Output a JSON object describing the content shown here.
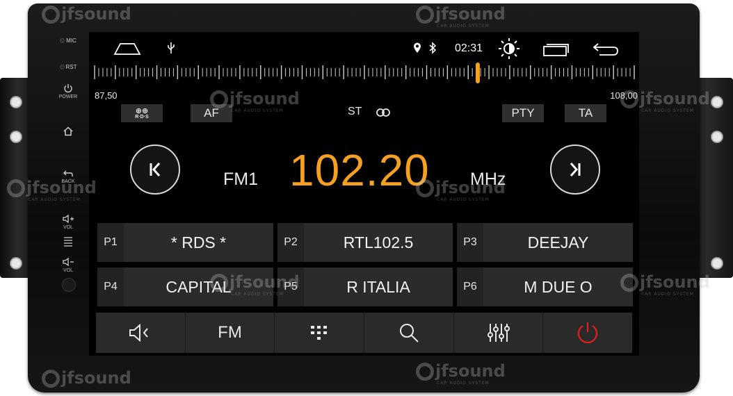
{
  "side_panel": {
    "mic_label": "MIC",
    "rst_label": "RST",
    "power_label": "POWER",
    "back_label": "BACK",
    "vol_up_label": "VOL",
    "vol_down_label": "VOL"
  },
  "status_bar": {
    "time": "02:31",
    "icons": [
      "home-icon",
      "usb-icon",
      "location-icon",
      "bluetooth-icon",
      "brightness-icon",
      "recent-apps-icon",
      "back-icon"
    ]
  },
  "tuner": {
    "min_freq": "87,50",
    "max_freq": "108,00",
    "needle_position_fraction": 0.71,
    "rds_label": "R·D·S",
    "af_label": "AF",
    "st_label": "ST",
    "pty_label": "PTY",
    "ta_label": "TA",
    "band": "FM1",
    "frequency": "102.20",
    "unit": "MHz"
  },
  "presets": [
    {
      "num": "P1",
      "name": "* RDS *"
    },
    {
      "num": "P2",
      "name": "RTL102.5"
    },
    {
      "num": "P3",
      "name": "DEEJAY"
    },
    {
      "num": "P4",
      "name": "CAPITAL"
    },
    {
      "num": "P5",
      "name": "R ITALIA"
    },
    {
      "num": "P6",
      "name": "M DUE O"
    }
  ],
  "toolbar": {
    "fm_label": "FM",
    "icons": [
      "speaker-icon",
      "grid-icon",
      "search-icon",
      "equalizer-icon",
      "power-icon"
    ]
  },
  "watermark": {
    "brand": "jfsound",
    "tagline": "CAR AUDIO SYSTEM"
  },
  "colors": {
    "frequency": "#f5a021",
    "needle": "#f5a021",
    "power_off": "#e02020"
  }
}
